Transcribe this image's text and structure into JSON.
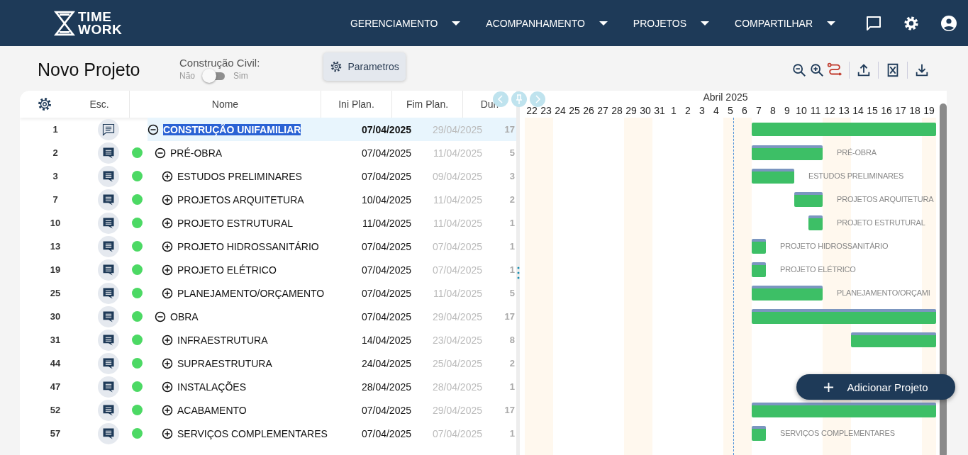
{
  "header": {
    "logo": [
      "TIME",
      "WORK"
    ],
    "menu": [
      {
        "label": "GERENCIAMENTO"
      },
      {
        "label": "ACOMPANHAMENTO"
      },
      {
        "label": "PROJETOS"
      },
      {
        "label": "COMPARTILHAR"
      }
    ]
  },
  "page": {
    "title": "Novo Projeto",
    "toggle": {
      "label": "Construção Civil:",
      "off_label": "Não",
      "on_label": "Sim",
      "on": false
    },
    "params_button": "Parametros"
  },
  "table": {
    "columns": [
      "Esc.",
      "Nome",
      "Ini Plan.",
      "Fim Plan.",
      "Dur."
    ],
    "rows": [
      {
        "number": "1",
        "kind": "project",
        "selected": true,
        "expanded": true,
        "name": "CONSTRUÇÃO UNIFAMILIAR",
        "start": "07/04/2025",
        "end": "29/04/2025",
        "duration": "17",
        "children": [
          {
            "number": "2",
            "kind": "task",
            "selected": false,
            "color": "#4cd964",
            "expanded": true,
            "name": "PRÉ-OBRA",
            "start": "07/04/2025",
            "end": "11/04/2025",
            "duration": "5",
            "bar_label": "PRÉ-OBRA",
            "children": [
              {
                "number": "3",
                "kind": "task",
                "selected": false,
                "color": "#4cd964",
                "expanded": false,
                "name": "ESTUDOS PRELIMINARES",
                "start": "07/04/2025",
                "end": "09/04/2025",
                "duration": "3",
                "bar_label": "ESTUDOS PRELIMINARES"
              },
              {
                "number": "7",
                "kind": "task",
                "selected": false,
                "color": "#4cd964",
                "expanded": false,
                "name": "PROJETOS ARQUITETURA",
                "start": "10/04/2025",
                "end": "11/04/2025",
                "duration": "2",
                "bar_label": "PROJETOS ARQUITETURA"
              },
              {
                "number": "10",
                "kind": "task",
                "selected": false,
                "color": "#4cd964",
                "expanded": false,
                "name": "PROJETO ESTRUTURAL",
                "start": "11/04/2025",
                "end": "11/04/2025",
                "duration": "1",
                "bar_label": "PROJETO ESTRUTURAL"
              },
              {
                "number": "13",
                "kind": "task",
                "selected": false,
                "color": "#4cd964",
                "expanded": false,
                "name": "PROJETO HIDROSSANITÁRIO",
                "start": "07/04/2025",
                "end": "07/04/2025",
                "duration": "1",
                "bar_label": "PROJETO HIDROSSANITÁRIO"
              },
              {
                "number": "19",
                "kind": "task",
                "selected": false,
                "color": "#4cd964",
                "expanded": false,
                "name": "PROJETO ELÉTRICO",
                "start": "07/04/2025",
                "end": "07/04/2025",
                "duration": "1",
                "bar_label": "PROJETO ELÉTRICO"
              },
              {
                "number": "25",
                "kind": "task",
                "selected": false,
                "color": "#4cd964",
                "expanded": false,
                "name": "PLANEJAMENTO/ORÇAMENTO",
                "start": "07/04/2025",
                "end": "11/04/2025",
                "duration": "5",
                "bar_label": "PLANEJAMENTO/ORÇAMI"
              }
            ]
          },
          {
            "number": "30",
            "kind": "task",
            "selected": false,
            "color": "#4cd964",
            "expanded": true,
            "name": "OBRA",
            "start": "07/04/2025",
            "end": "29/04/2025",
            "duration": "17",
            "children": [
              {
                "number": "31",
                "kind": "task",
                "selected": false,
                "color": "#4cd964",
                "expanded": false,
                "name": "INFRAESTRUTURA",
                "start": "14/04/2025",
                "end": "23/04/2025",
                "duration": "8"
              },
              {
                "number": "44",
                "kind": "task",
                "selected": false,
                "color": "#4cd964",
                "expanded": false,
                "name": "SUPRAESTRUTURA",
                "start": "24/04/2025",
                "end": "25/04/2025",
                "duration": "2"
              },
              {
                "number": "47",
                "kind": "task",
                "selected": false,
                "color": "#4cd964",
                "expanded": false,
                "name": "INSTALAÇÕES",
                "start": "28/04/2025",
                "end": "28/04/2025",
                "duration": "1"
              },
              {
                "number": "52",
                "kind": "task",
                "selected": false,
                "color": "#4cd964",
                "expanded": false,
                "name": "ACABAMENTO",
                "start": "07/04/2025",
                "end": "29/04/2025",
                "duration": "17"
              },
              {
                "number": "57",
                "kind": "task",
                "selected": false,
                "color": "#4cd964",
                "expanded": false,
                "name": "SERVIÇOS COMPLEMENTARES",
                "start": "07/04/2025",
                "end": "07/04/2025",
                "duration": "1",
                "bar_label": "SERVIÇOS COMPLEMENTARES"
              }
            ]
          }
        ]
      }
    ]
  },
  "gantt": {
    "month": "Abril 2025",
    "days": [
      "22",
      "23",
      "24",
      "25",
      "26",
      "27",
      "28",
      "29",
      "30",
      "31",
      "1",
      "2",
      "3",
      "4",
      "5",
      "6",
      "7",
      "8",
      "9",
      "10",
      "11",
      "12",
      "13",
      "14",
      "15",
      "16",
      "17",
      "18",
      "19"
    ],
    "add_button": "Adicionar Projeto"
  }
}
